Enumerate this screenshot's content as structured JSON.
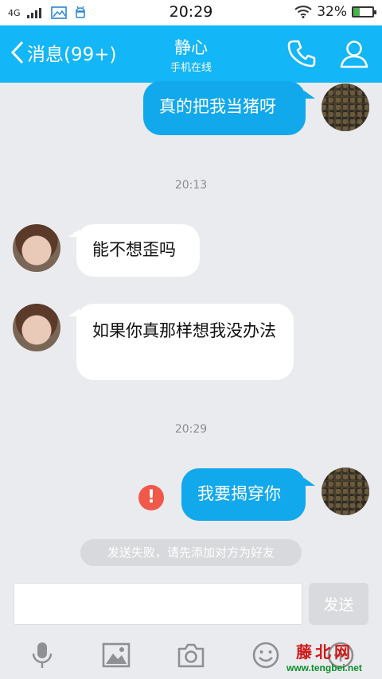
{
  "status_bar": {
    "network": "4G",
    "time": "20:29",
    "battery": "32%",
    "battery_level": 0.32,
    "battery_color": "#4caf50"
  },
  "header": {
    "back_label": "消息(99+)",
    "title": "静心",
    "subtitle": "手机在线",
    "bg_color": "#13b6f6"
  },
  "messages": [
    {
      "side": "out",
      "text": "真的把我当猪呀"
    },
    {
      "side": "time",
      "text": "20:13"
    },
    {
      "side": "in",
      "text": "能不想歪吗"
    },
    {
      "side": "in",
      "text": "如果你真那样想我没办法"
    },
    {
      "side": "time",
      "text": "20:29"
    },
    {
      "side": "out",
      "text": "我要揭穿你",
      "failed": true,
      "error_mark": "!"
    }
  ],
  "notice": "发送失败，请先添加对方为好友",
  "composer": {
    "value": "",
    "send_label": "发送"
  },
  "toolbar": {
    "icons": [
      "microphone-icon",
      "image-icon",
      "camera-icon",
      "emoji-icon",
      "plus-icon"
    ]
  },
  "watermark": {
    "logo_text": "藤北网",
    "url": "www.tengbei.net"
  }
}
